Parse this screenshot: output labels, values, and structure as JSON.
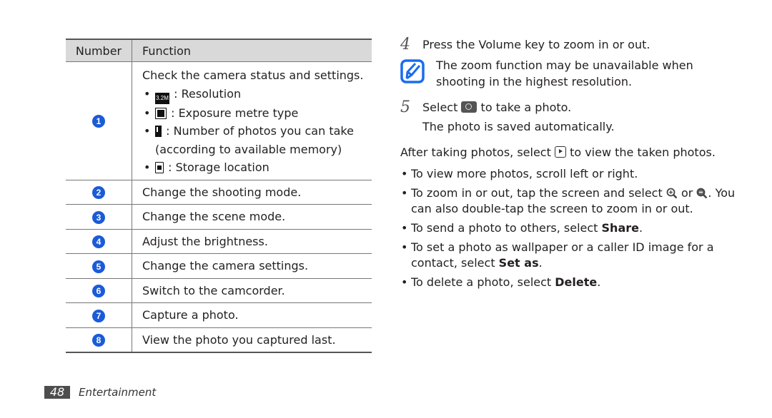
{
  "table": {
    "headers": {
      "number": "Number",
      "function": "Function"
    },
    "first_row": {
      "badge": "1",
      "intro": "Check the camera status and settings.",
      "items": [
        {
          "icon": "resolution-icon",
          "icon_text": "3.2M",
          "label": ": Resolution"
        },
        {
          "icon": "exposure-metre-icon",
          "label": ": Exposure metre type"
        },
        {
          "icon": "photo-count-icon",
          "label": ": Number of photos you can take",
          "continuation": "(according to available memory)"
        },
        {
          "icon": "storage-location-icon",
          "label": ": Storage location"
        }
      ]
    },
    "rows": [
      {
        "badge": "2",
        "text": "Change the shooting mode."
      },
      {
        "badge": "3",
        "text": "Change the scene mode."
      },
      {
        "badge": "4",
        "text": "Adjust the brightness."
      },
      {
        "badge": "5",
        "text": "Change the camera settings."
      },
      {
        "badge": "6",
        "text": "Switch to the camcorder."
      },
      {
        "badge": "7",
        "text": "Capture a photo."
      },
      {
        "badge": "8",
        "text": "View the photo you captured last."
      }
    ]
  },
  "steps": {
    "step4": {
      "num": "4",
      "text": "Press the Volume key to zoom in or out."
    },
    "note": {
      "line1": "The zoom function may be unavailable when",
      "line2": "shooting in the highest resolution."
    },
    "step5": {
      "num": "5",
      "pre": "Select",
      "post": "to take a photo.",
      "line2": "The photo is saved automatically."
    }
  },
  "after": {
    "pre": "After taking photos, select",
    "post": "to view the taken photos."
  },
  "bullets": [
    {
      "text": "To view more photos, scroll left or right."
    },
    {
      "pre": "To zoom in or out, tap the screen and select",
      "mid": "or",
      "post": ". You can also double-tap the screen to zoom in or out."
    },
    {
      "pre": "To send a photo to others, select ",
      "bold": "Share",
      "post": "."
    },
    {
      "pre": "To set a photo as wallpaper or a caller ID image for a contact, select ",
      "bold": "Set as",
      "post": "."
    },
    {
      "pre": "To delete a photo, select ",
      "bold": "Delete",
      "post": "."
    }
  ],
  "footer": {
    "page_number": "48",
    "section": "Entertainment"
  },
  "colors": {
    "badge_blue": "#1a5bd8",
    "note_icon_blue": "#1a6cf0",
    "header_gray": "#d9d9d9"
  }
}
